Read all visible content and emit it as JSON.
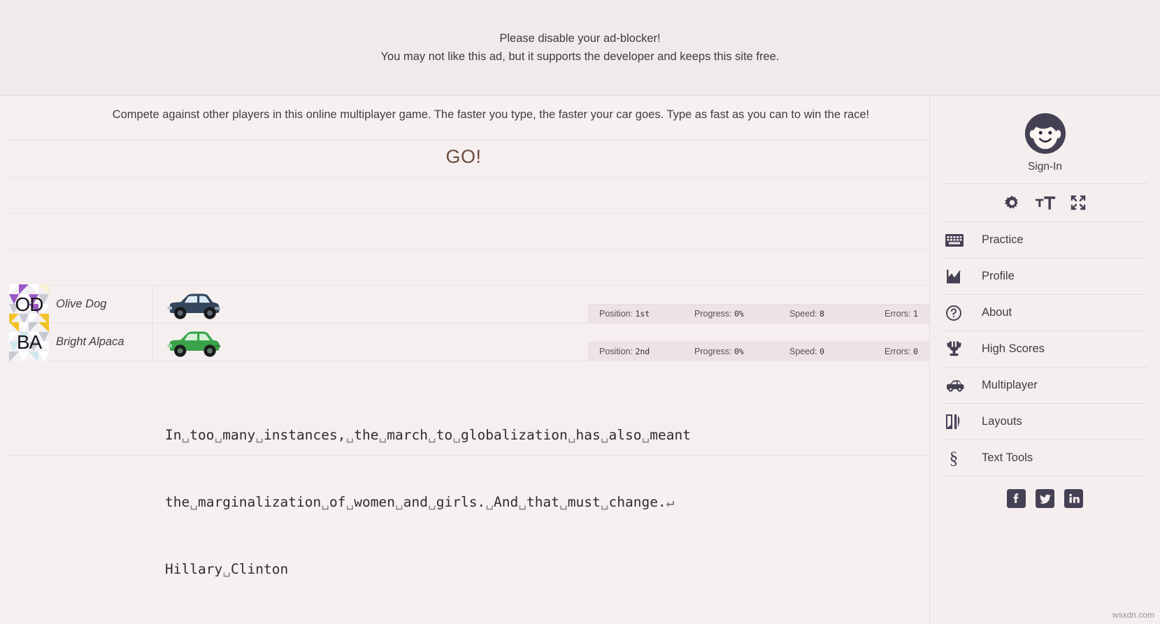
{
  "ad": {
    "line1": "Please disable your ad-blocker!",
    "line2": "You may not like this ad, but it supports the developer and keeps this site free."
  },
  "main": {
    "intro": "Compete against other players in this online multiplayer game. The faster you type, the faster your car goes. Type as fast as you can to win the race!",
    "go_text": "GO!",
    "players": [
      {
        "initials": "OD",
        "name": "Olive Dog",
        "car_color": "#33465c",
        "position_label": "Position:",
        "position_value": "1st",
        "progress_label": "Progress:",
        "progress_value": "0%",
        "speed_label": "Speed:",
        "speed_value": "8",
        "errors_label": "Errors:",
        "errors_value": "1"
      },
      {
        "initials": "BA",
        "name": "Bright Alpaca",
        "car_color": "#3aa349",
        "position_label": "Position:",
        "position_value": "2nd",
        "progress_label": "Progress:",
        "progress_value": "0%",
        "speed_label": "Speed:",
        "speed_value": "0",
        "errors_label": "Errors:",
        "errors_value": "0"
      }
    ],
    "typing_lines": [
      "In too many instances, the march to globalization has also meant",
      "the marginalization of women and girls. And that must change.↵",
      "Hillary Clinton"
    ]
  },
  "sidebar": {
    "signin_label": "Sign-In",
    "tools": [
      {
        "icon": "gear-icon"
      },
      {
        "icon": "font-size-icon"
      },
      {
        "icon": "fullscreen-icon"
      }
    ],
    "nav": [
      {
        "icon": "keyboard-icon",
        "label": "Practice"
      },
      {
        "icon": "chart-icon",
        "label": "Profile"
      },
      {
        "icon": "question-icon",
        "label": "About"
      },
      {
        "icon": "trophy-icon",
        "label": "High Scores"
      },
      {
        "icon": "car-icon",
        "label": "Multiplayer"
      },
      {
        "icon": "layouts-icon",
        "label": "Layouts"
      },
      {
        "icon": "section-icon",
        "label": "Text Tools"
      }
    ],
    "social": [
      {
        "icon": "facebook-icon"
      },
      {
        "icon": "twitter-icon"
      },
      {
        "icon": "linkedin-icon"
      }
    ]
  },
  "watermark": "wsxdn.com",
  "colors": {
    "page_bg": "#f4eeee",
    "track_bg": "#f6efef",
    "go_text": "#6b4b3c",
    "text": "#3f3c44",
    "icon": "#454154"
  }
}
